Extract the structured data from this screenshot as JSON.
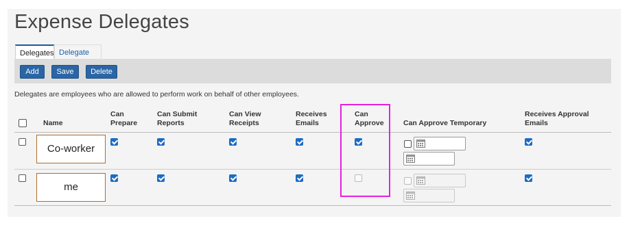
{
  "page": {
    "title": "Expense Delegates"
  },
  "tabs": [
    {
      "label": "Delegates",
      "active": true
    },
    {
      "label": "Delegate For",
      "active": false
    }
  ],
  "toolbar": {
    "add_label": "Add",
    "save_label": "Save",
    "delete_label": "Delete"
  },
  "description": "Delegates are employees who are allowed to perform work on behalf of other employees.",
  "table": {
    "headers": {
      "select_all": "",
      "name": "Name",
      "can_prepare": [
        "Can",
        "Prepare"
      ],
      "can_submit": [
        "Can Submit",
        "Reports"
      ],
      "can_view": [
        "Can View",
        "Receipts"
      ],
      "receives_emails": [
        "Receives",
        "Emails"
      ],
      "can_approve": [
        "Can",
        "Approve"
      ],
      "can_approve_temp": "Can Approve Temporary",
      "receives_approval": [
        "Receives Approval",
        "Emails"
      ]
    },
    "rows": [
      {
        "name": "Co-worker",
        "selected": false,
        "can_prepare": true,
        "can_submit": true,
        "can_view": true,
        "receives_emails": true,
        "can_approve": true,
        "can_approve_temp": false,
        "temp_enabled": true,
        "receives_approval": true
      },
      {
        "name": "me",
        "selected": false,
        "can_prepare": true,
        "can_submit": true,
        "can_view": true,
        "receives_emails": true,
        "can_approve": false,
        "can_approve_temp": false,
        "temp_enabled": false,
        "receives_approval": true
      }
    ]
  },
  "colors": {
    "accent": "#2a66a5",
    "checkbox": "#1e6bc4",
    "highlight": "#e61fe0",
    "name_box_border": "#b06a2c"
  },
  "icons": {
    "calendar": "calendar-icon"
  }
}
